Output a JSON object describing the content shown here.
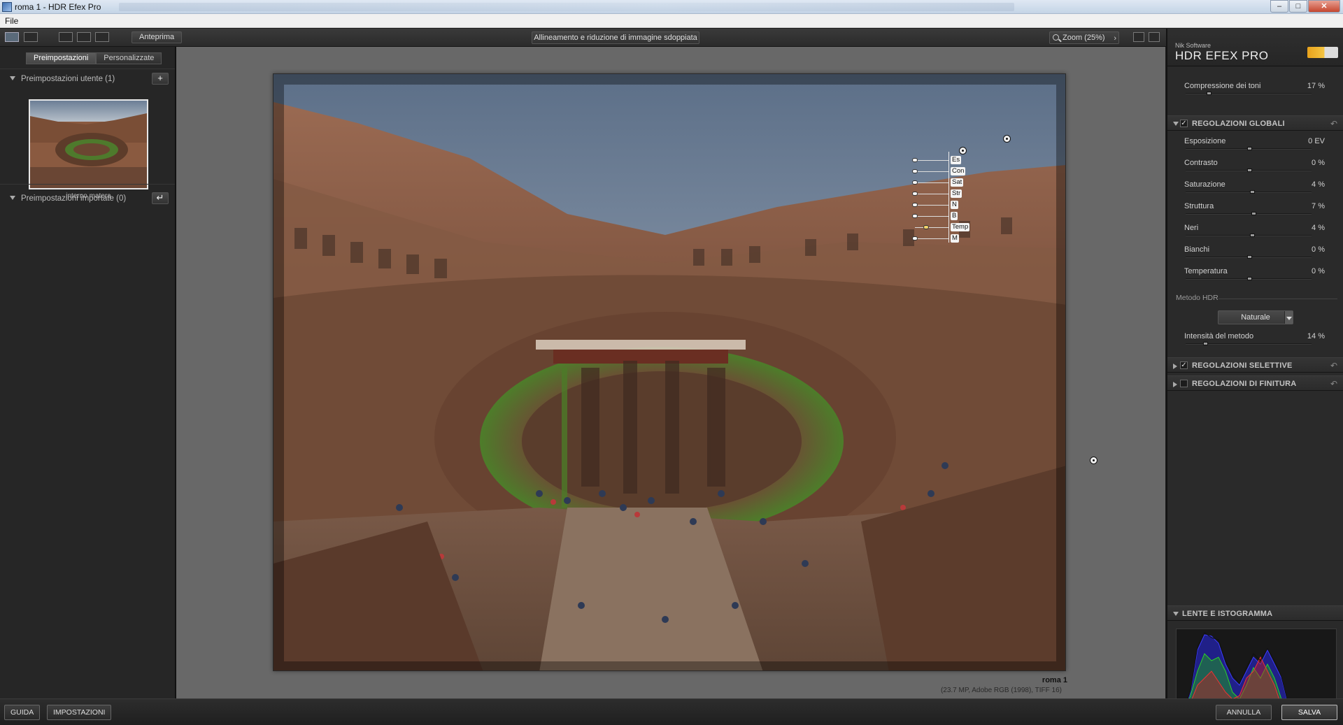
{
  "window": {
    "title": "roma 1 - HDR Efex Pro",
    "min": "–",
    "max": "□",
    "close": "✕"
  },
  "menu": {
    "file": "File"
  },
  "toolbar": {
    "preview_label": "Anteprima",
    "center_label": "Allineamento e riduzione di immagine sdoppiata",
    "zoom_label": "Zoom (25%)"
  },
  "left_panel": {
    "tabs": [
      "Preimpostazioni",
      "Personalizzate"
    ],
    "user_presets_title": "Preimpostazioni utente (1)",
    "add_label": "+",
    "preset_name": "interno matera",
    "imported_title": "Preimpostazioni importate (0)",
    "import_label": "↵"
  },
  "image": {
    "name": "roma 1",
    "info": "(23.7 MP, Adobe RGB (1998), TIFF 16)"
  },
  "control_point": {
    "rows": [
      {
        "label": "Es",
        "value": 0.0
      },
      {
        "label": "Con",
        "value": 0.0
      },
      {
        "label": "Sat",
        "value": 0.0
      },
      {
        "label": "Str",
        "value": 0.0
      },
      {
        "label": "N",
        "value": 0.0
      },
      {
        "label": "B",
        "value": 0.0
      },
      {
        "label": "Temp",
        "value": 0.35
      },
      {
        "label": "M",
        "value": 0.0
      }
    ]
  },
  "right_panel": {
    "brand_small": "Nik Software",
    "brand_product": "HDR EFEX PRO",
    "tone_compression": {
      "label": "Compressione dei toni",
      "value": "17 %",
      "level": 0.17
    },
    "global_header": "REGOLAZIONI GLOBALI",
    "global_checked": "✓",
    "globals": [
      {
        "label": "Esposizione",
        "value": "0 EV",
        "level": 0.5
      },
      {
        "label": "Contrasto",
        "value": "0 %",
        "level": 0.5
      },
      {
        "label": "Saturazione",
        "value": "4 %",
        "level": 0.52
      },
      {
        "label": "Struttura",
        "value": "7 %",
        "level": 0.535
      },
      {
        "label": "Neri",
        "value": "4 %",
        "level": 0.52
      },
      {
        "label": "Bianchi",
        "value": "0 %",
        "level": 0.5
      },
      {
        "label": "Temperatura",
        "value": "0 %",
        "level": 0.5
      }
    ],
    "method_label": "Metodo HDR",
    "method_value": "Naturale",
    "method_intensity": {
      "label": "Intensità del metodo",
      "value": "14 %",
      "level": 0.14
    },
    "selective_header": "REGOLAZIONI SELETTIVE",
    "selective_checked": "✓",
    "finishing_header": "REGOLAZIONI DI FINITURA",
    "finishing_checked": "",
    "histogram_header": "LENTE E ISTOGRAMMA",
    "reset_icon": "↶"
  },
  "bottom": {
    "guide": "GUIDA",
    "settings": "IMPOSTAZIONI",
    "cancel": "ANNULLA",
    "save": "SALVA"
  },
  "colors": {
    "panel": "#2a2a2a",
    "canvas": "#686868",
    "accent": "#f2d36b"
  }
}
